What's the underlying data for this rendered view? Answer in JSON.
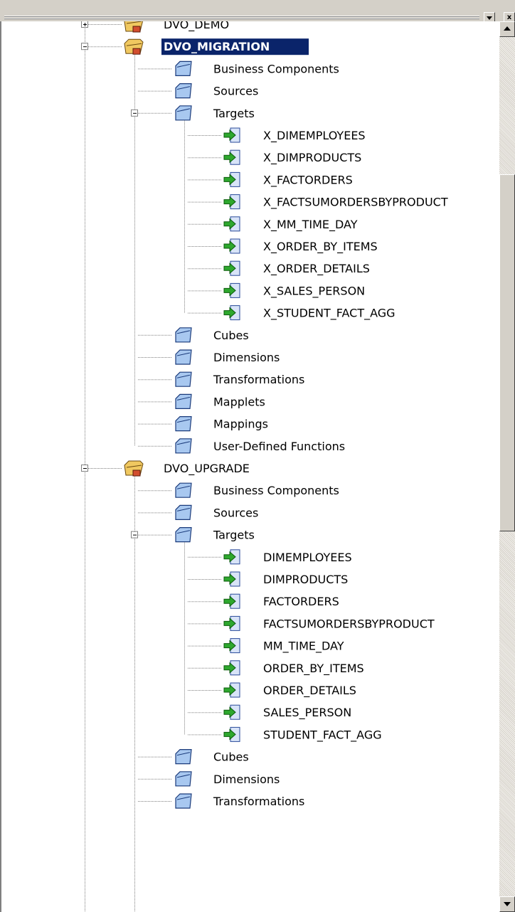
{
  "window": {
    "dropdown_icon": "dropdown-arrow-icon",
    "close_icon": "close-icon",
    "close_glyph": "x"
  },
  "colors": {
    "selection": "#0a246a",
    "folder_blue": "#a8c8f0",
    "repo_folder": "#f0c860",
    "target_arrow": "#2ea82e",
    "line_gray": "#808080"
  },
  "tree": [
    {
      "label": "DVO_DEMO",
      "type": "repository",
      "state": "collapsed",
      "children": []
    },
    {
      "label": "DVO_MIGRATION",
      "type": "repository",
      "state": "expanded",
      "selected": true,
      "children": [
        {
          "label": "Business Components",
          "type": "folder"
        },
        {
          "label": "Sources",
          "type": "folder"
        },
        {
          "label": "Targets",
          "type": "folder",
          "state": "expanded",
          "children": [
            {
              "label": "X_DIMEMPLOYEES",
              "type": "target"
            },
            {
              "label": "X_DIMPRODUCTS",
              "type": "target"
            },
            {
              "label": "X_FACTORDERS",
              "type": "target"
            },
            {
              "label": "X_FACTSUMORDERSBYPRODUCT",
              "type": "target"
            },
            {
              "label": "X_MM_TIME_DAY",
              "type": "target"
            },
            {
              "label": "X_ORDER_BY_ITEMS",
              "type": "target"
            },
            {
              "label": "X_ORDER_DETAILS",
              "type": "target"
            },
            {
              "label": "X_SALES_PERSON",
              "type": "target"
            },
            {
              "label": "X_STUDENT_FACT_AGG",
              "type": "target"
            }
          ]
        },
        {
          "label": "Cubes",
          "type": "folder"
        },
        {
          "label": "Dimensions",
          "type": "folder"
        },
        {
          "label": "Transformations",
          "type": "folder"
        },
        {
          "label": "Mapplets",
          "type": "folder"
        },
        {
          "label": "Mappings",
          "type": "folder"
        },
        {
          "label": "User-Defined Functions",
          "type": "folder"
        }
      ]
    },
    {
      "label": "DVO_UPGRADE",
      "type": "repository",
      "state": "expanded",
      "children": [
        {
          "label": "Business Components",
          "type": "folder"
        },
        {
          "label": "Sources",
          "type": "folder"
        },
        {
          "label": "Targets",
          "type": "folder",
          "state": "expanded",
          "children": [
            {
              "label": "DIMEMPLOYEES",
              "type": "target"
            },
            {
              "label": "DIMPRODUCTS",
              "type": "target"
            },
            {
              "label": "FACTORDERS",
              "type": "target"
            },
            {
              "label": "FACTSUMORDERSBYPRODUCT",
              "type": "target"
            },
            {
              "label": "MM_TIME_DAY",
              "type": "target"
            },
            {
              "label": "ORDER_BY_ITEMS",
              "type": "target"
            },
            {
              "label": "ORDER_DETAILS",
              "type": "target"
            },
            {
              "label": "SALES_PERSON",
              "type": "target"
            },
            {
              "label": "STUDENT_FACT_AGG",
              "type": "target"
            }
          ]
        },
        {
          "label": "Cubes",
          "type": "folder"
        },
        {
          "label": "Dimensions",
          "type": "folder"
        },
        {
          "label": "Transformations",
          "type": "folder"
        }
      ]
    }
  ],
  "scrollbar": {
    "up_icon": "scroll-up-arrow-icon",
    "down_icon": "scroll-down-arrow-icon",
    "scroll_position": 0.2
  }
}
